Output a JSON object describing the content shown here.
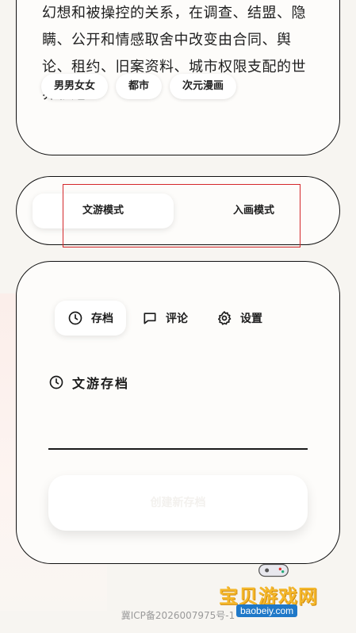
{
  "story": {
    "text": "幻想和被操控的关系，在调查、结盟、隐瞒、公开和情感取舍中改变由合同、舆论、租约、旧案资料、城市权限支配的世界轨迹。",
    "tags": [
      "男男女女",
      "都市",
      "次元漫画"
    ]
  },
  "mode_switch": {
    "tabs": [
      {
        "label": "文游模式",
        "active": true
      },
      {
        "label": "入画模式",
        "active": false
      }
    ]
  },
  "panel": {
    "tabs": [
      {
        "label": "存档",
        "icon": "clock-icon",
        "active": true
      },
      {
        "label": "评论",
        "icon": "comment-icon",
        "active": false
      },
      {
        "label": "设置",
        "icon": "gear-icon",
        "active": false
      }
    ],
    "section_title": "文游存档",
    "section_icon": "clock-icon",
    "ghost_button_label": "创建新存档"
  },
  "footer": {
    "icp": "冀ICP备2026007975号-1"
  },
  "watermark": {
    "brand_cn": "宝贝游戏网",
    "brand_en": "baobeiy.com"
  },
  "colors": {
    "highlight": "#d4272a",
    "background": "#f7f5f1",
    "card": "#fdfcfa",
    "border": "#111111"
  }
}
